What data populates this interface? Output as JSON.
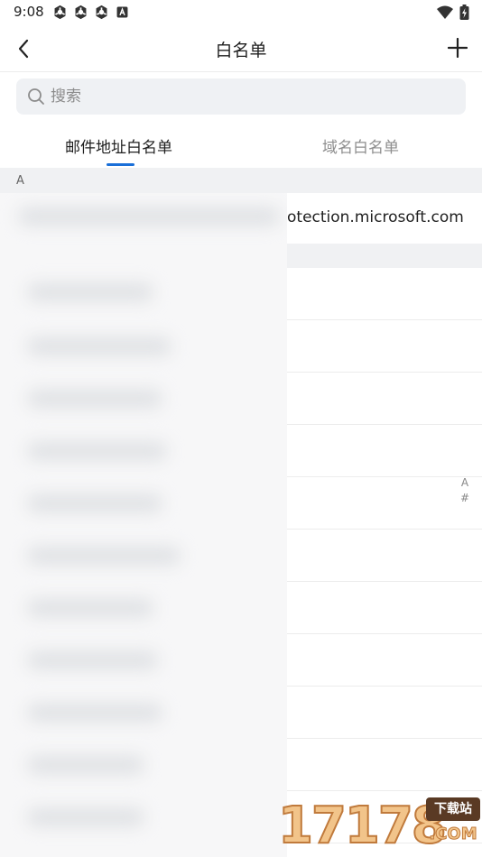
{
  "status_bar": {
    "time": "9:08",
    "notification_icons": [
      "app-notification-icon",
      "app-notification-icon",
      "app-notification-icon",
      "keyboard-a-icon"
    ],
    "right_icons": [
      "wifi-icon",
      "battery-charging-icon"
    ]
  },
  "app_bar": {
    "title": "白名单",
    "back_icon": "chevron-left-icon",
    "add_icon": "plus-icon"
  },
  "search": {
    "placeholder": "搜索",
    "value": ""
  },
  "tabs": [
    {
      "label": "邮件地址白名单",
      "active": true
    },
    {
      "label": "域名白名单",
      "active": false
    }
  ],
  "sections": [
    {
      "letter": "A"
    },
    {
      "letter": ""
    }
  ],
  "entries": [
    {
      "visible_text": "otection.microsoft.com"
    }
  ],
  "index_bar": [
    "A",
    "#"
  ],
  "watermark": {
    "digits": "17178",
    "tag": "下载站",
    "suffix": ".COM"
  },
  "colors": {
    "accent": "#1a6fd8",
    "section_bg": "#f0f1f3",
    "search_bg": "#eff1f4"
  }
}
